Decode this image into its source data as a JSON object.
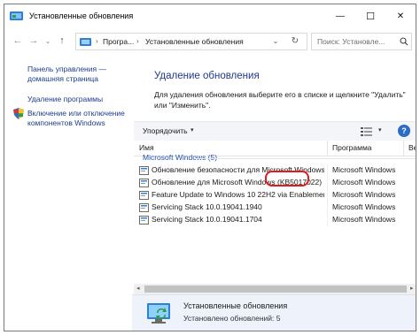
{
  "window": {
    "title": "Установленные обновления",
    "minimize_glyph": "—",
    "maximize_glyph": "☐",
    "close_glyph": "✕"
  },
  "nav": {
    "back_glyph": "←",
    "forward_glyph": "→",
    "recent_glyph": "⌄",
    "up_glyph": "↑"
  },
  "address": {
    "crumbs": [
      "Програ...",
      "Установленные обновления"
    ],
    "separator": "›",
    "dropdown_glyph": "⌄",
    "refresh_glyph": "↻"
  },
  "search": {
    "placeholder": "Поиск: Установле..."
  },
  "left_pane": {
    "links": [
      {
        "label_line1": "Панель управления —",
        "label_line2": "домашняя страница"
      },
      {
        "label_line1": "Удаление программы",
        "label_line2": ""
      },
      {
        "label_line1": "Включение или отключение",
        "label_line2": "компонентов Windows"
      }
    ]
  },
  "main": {
    "heading": "Удаление обновления",
    "description": "Для удаления обновления выберите его в списке и щелкните \"Удалить\" или \"Изменить\"."
  },
  "toolbar": {
    "organize_label": "Упорядочить",
    "caret": "▾",
    "view_caret": "▾",
    "help_label": "?"
  },
  "columns": {
    "name": "Имя",
    "program": "Программа",
    "version": "Ве"
  },
  "group": {
    "label": "Microsoft Windows (5)"
  },
  "rows": [
    {
      "name": "Обновление безопасности для Microsoft Windows",
      "program": "Microsoft Windows"
    },
    {
      "name": "Обновление для Microsoft Windows (KB5017022)",
      "program": "Microsoft Windows"
    },
    {
      "name": "Feature Update to Windows 10 22H2 via Enablement",
      "program": "Microsoft Windows"
    },
    {
      "name": "Servicing Stack 10.0.19041.1940",
      "program": "Microsoft Windows"
    },
    {
      "name": "Servicing Stack 10.0.19041.1704",
      "program": "Microsoft Windows"
    }
  ],
  "scroll": {
    "left_glyph": "◂",
    "right_glyph": "▸"
  },
  "details": {
    "title": "Установленные обновления",
    "count_text": "Установлено обновлений: 5"
  },
  "colors": {
    "link": "#1a3e8c",
    "heading": "#1e3a8a",
    "highlight": "#e01b1b",
    "group": "#1e4ea8"
  }
}
